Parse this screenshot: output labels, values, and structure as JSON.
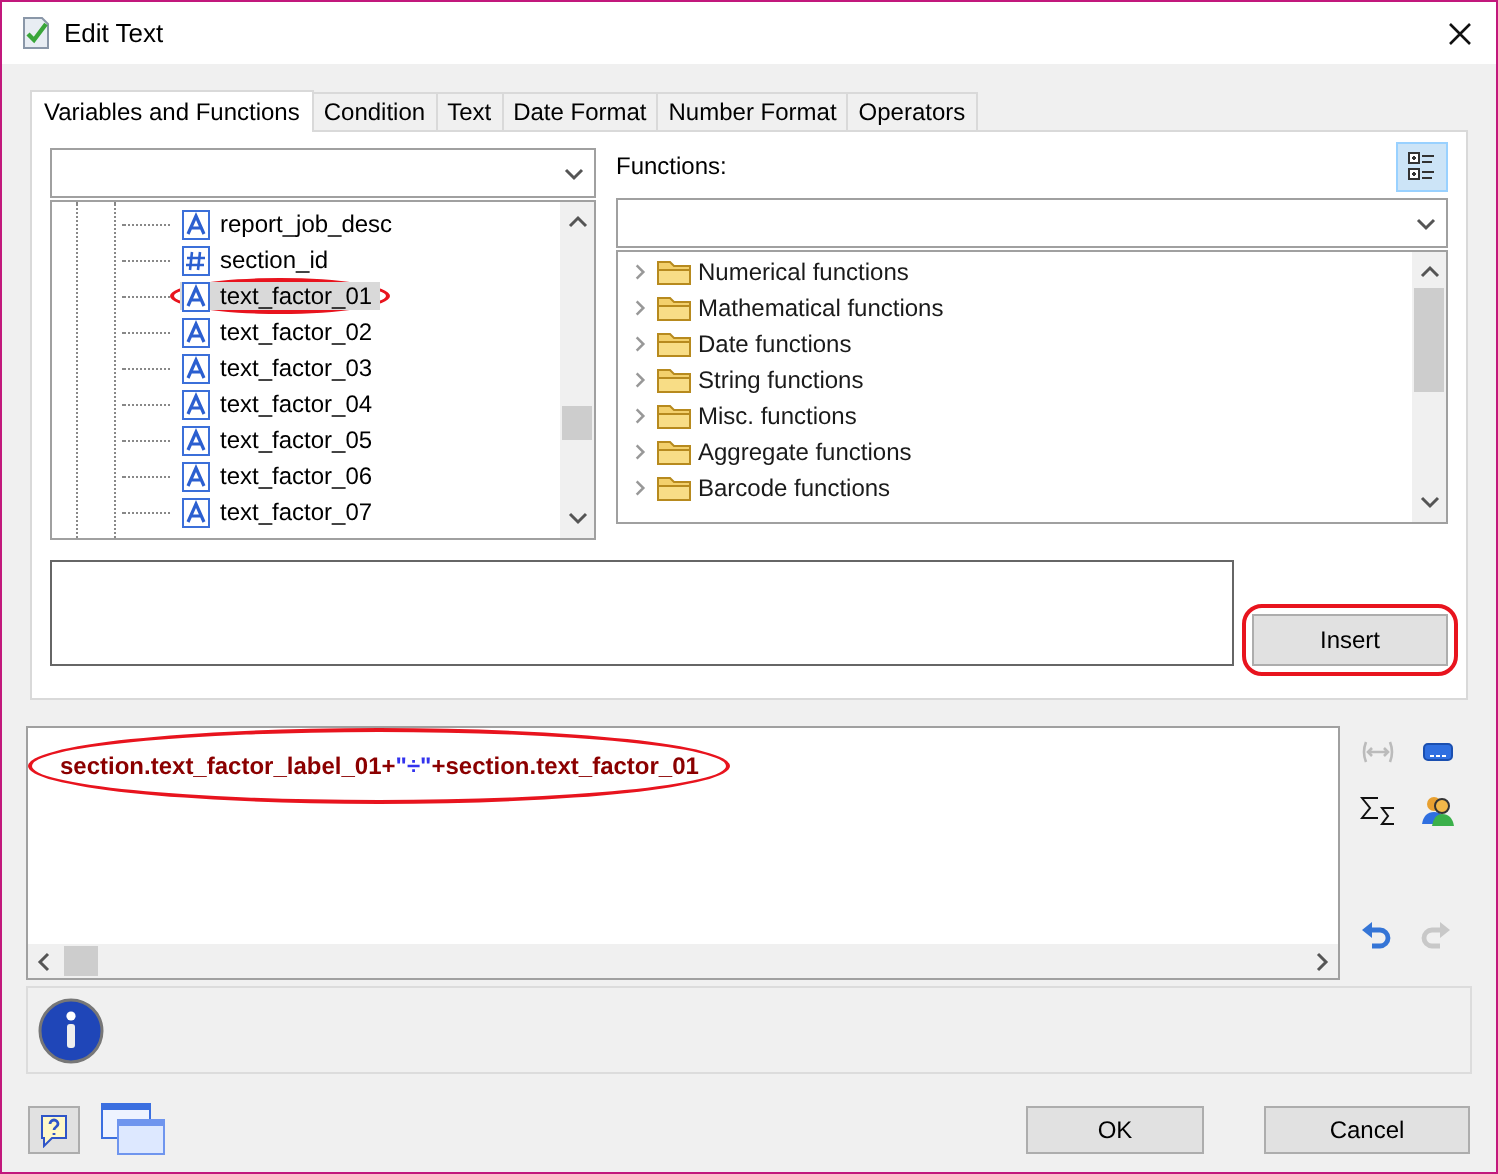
{
  "window": {
    "title": "Edit Text"
  },
  "tabs": [
    {
      "label": "Variables and Functions",
      "selected": true
    },
    {
      "label": "Condition",
      "selected": false
    },
    {
      "label": "Text",
      "selected": false
    },
    {
      "label": "Date Format",
      "selected": false
    },
    {
      "label": "Number Format",
      "selected": false
    },
    {
      "label": "Operators",
      "selected": false
    }
  ],
  "variables": {
    "items": [
      {
        "label": "report_job_desc",
        "kind": "text",
        "selected": false,
        "circled": false
      },
      {
        "label": "section_id",
        "kind": "number",
        "selected": false,
        "circled": false
      },
      {
        "label": "text_factor_01",
        "kind": "text",
        "selected": true,
        "circled": true
      },
      {
        "label": "text_factor_02",
        "kind": "text",
        "selected": false,
        "circled": false
      },
      {
        "label": "text_factor_03",
        "kind": "text",
        "selected": false,
        "circled": false
      },
      {
        "label": "text_factor_04",
        "kind": "text",
        "selected": false,
        "circled": false
      },
      {
        "label": "text_factor_05",
        "kind": "text",
        "selected": false,
        "circled": false
      },
      {
        "label": "text_factor_06",
        "kind": "text",
        "selected": false,
        "circled": false
      },
      {
        "label": "text_factor_07",
        "kind": "text",
        "selected": false,
        "circled": false
      }
    ]
  },
  "functions": {
    "label": "Functions:",
    "items": [
      {
        "label": "Numerical functions"
      },
      {
        "label": "Mathematical functions"
      },
      {
        "label": "Date functions"
      },
      {
        "label": "String functions"
      },
      {
        "label": "Misc. functions"
      },
      {
        "label": "Aggregate functions"
      },
      {
        "label": "Barcode functions"
      }
    ]
  },
  "insert_button": {
    "label": "Insert",
    "circled": true
  },
  "expression": {
    "circled": true,
    "segments": [
      {
        "kind": "identifier",
        "text": "section.text_factor_label_01+"
      },
      {
        "kind": "string",
        "text": "\"÷\""
      },
      {
        "kind": "identifier",
        "text": "+section.text_factor_01"
      }
    ]
  },
  "buttons": [
    {
      "label": "OK"
    },
    {
      "label": "Cancel"
    }
  ]
}
